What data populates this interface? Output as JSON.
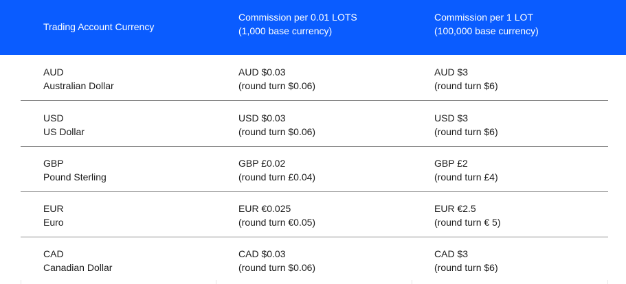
{
  "header": {
    "col1": "Trading Account Currency",
    "col2_line1": "Commission per 0.01 LOTS",
    "col2_line2": "(1,000 base currency)",
    "col3_line1": "Commission per 1 LOT",
    "col3_line2": "(100,000 base currency)"
  },
  "rows": [
    {
      "code": "AUD",
      "name": "Australian Dollar",
      "c2a": "AUD $0.03",
      "c2b": "(round turn $0.06)",
      "c3a": "AUD $3",
      "c3b": "(round turn $6)"
    },
    {
      "code": "USD",
      "name": "US Dollar",
      "c2a": "USD $0.03",
      "c2b": "(round turn $0.06)",
      "c3a": "USD $3",
      "c3b": "(round turn $6)"
    },
    {
      "code": "GBP",
      "name": "Pound Sterling",
      "c2a": "GBP £0.02",
      "c2b": "(round turn £0.04)",
      "c3a": "GBP £2",
      "c3b": "(round turn £4)"
    },
    {
      "code": "EUR",
      "name": "Euro",
      "c2a": "EUR €0.025",
      "c2b": "(round turn €0.05)",
      "c3a": "EUR €2.5",
      "c3b": "(round turn € 5)"
    },
    {
      "code": "CAD",
      "name": "Canadian Dollar",
      "c2a": "CAD $0.03",
      "c2b": "(round turn $0.06)",
      "c3a": "CAD $3",
      "c3b": "(round turn $6)"
    }
  ],
  "colors": {
    "header_bg": "#0a5cff",
    "header_text": "#ffffff",
    "divider": "#8a8a8a"
  }
}
